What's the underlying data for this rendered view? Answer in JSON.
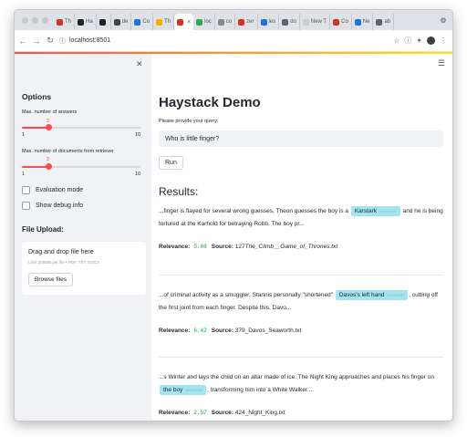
{
  "browser": {
    "tabs": [
      {
        "label": "Th",
        "color": "#d93025"
      },
      {
        "label": "Ha",
        "color": "#222222"
      },
      {
        "label": "",
        "color": "#222222"
      },
      {
        "label": "de",
        "color": "#444444"
      },
      {
        "label": "Co",
        "color": "#1a73e8"
      },
      {
        "label": "Th",
        "color": "#f9ab00"
      },
      {
        "label": "",
        "color": "#d93025",
        "active": true
      },
      {
        "label": "loc",
        "color": "#34a853"
      },
      {
        "label": "co",
        "color": "#888888"
      },
      {
        "label": "zer",
        "color": "#d93025"
      },
      {
        "label": "les",
        "color": "#1a73e8"
      },
      {
        "label": "do",
        "color": "#5f6368"
      },
      {
        "label": "New T",
        "color": "#cccccc"
      },
      {
        "label": "Co",
        "color": "#d93025"
      },
      {
        "label": "Ne",
        "color": "#1a73e8"
      },
      {
        "label": "ab",
        "color": "#5f6368"
      }
    ],
    "url": "localhost:8501"
  },
  "sidebar": {
    "options_title": "Options",
    "slider_answers": {
      "label": "Max. number of answers",
      "value": "3",
      "min": "1",
      "max": "10",
      "fraction": 0.222
    },
    "slider_docs": {
      "label": "Max. number of documents from retriever",
      "value": "3",
      "min": "1",
      "max": "10",
      "fraction": 0.222
    },
    "checkbox_eval": "Evaluation mode",
    "checkbox_debug": "Show debug info",
    "upload_title": "File Upload:",
    "drop_title": "Drag and drop file here",
    "drop_hint": "Limit 200MB per file • PDF, TXT, DOCX",
    "browse_label": "Browse files"
  },
  "main": {
    "title": "Haystack Demo",
    "query_label": "Please provide your query:",
    "query_value": "Who is little finger?",
    "run_label": "Run",
    "results_title": "Results:",
    "answer_tag": "ANSWER",
    "relevance_label": "Relevance:",
    "source_label": "Source:",
    "results": [
      {
        "pre": "...finger is flayed for several wrong guesses, Theon guesses the boy is a ",
        "answer": "Karstark",
        "post": " and he is being tortured at the Karhold for betraying Robb. The boy pr...",
        "score": "5.08",
        "source_num": "127",
        "source_name": "The_Climb__Game_of_Thrones.txt"
      },
      {
        "pre": "...of criminal activity as a smuggler, Stannis personally \"shortened\" ",
        "answer": "Davos's left hand",
        "post": ", cutting off the first joint from each finger. Despite this, Davo...",
        "score": "6.42",
        "source_num": "379_",
        "source_name": "Davos_Seaworth.txt"
      },
      {
        "pre": "...s Winter and lays the child on an altar made of ice. The Night King approaches and places his finger on ",
        "answer": "the boy",
        "post": ", transforming him into a White Walker....",
        "score": "2.97",
        "source_num": "424_",
        "source_name": "Night_King.txt"
      }
    ]
  }
}
